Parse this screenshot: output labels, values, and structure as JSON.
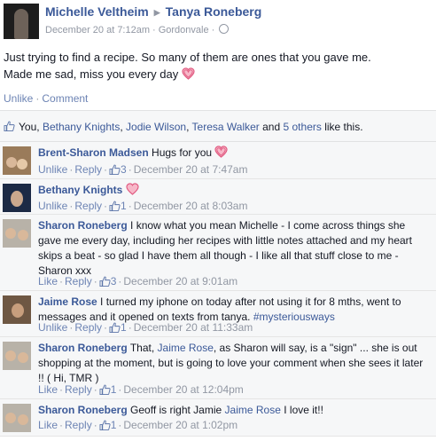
{
  "post": {
    "author": "Michelle Veltheim",
    "target": "Tanya Roneberg",
    "timestamp": "December 20 at 7:12am",
    "location": "Gordonvale",
    "text_line1": "Just trying to find a recipe. So many of them are ones that you gave me.",
    "text_line2": "Made me sad, miss you every day",
    "actions": {
      "unlike": "Unlike",
      "comment": "Comment"
    },
    "heart_icon": "heart-icon",
    "privacy_icon": "globe-icon"
  },
  "likes": {
    "you": "You",
    "comma": ",",
    "name1": "Bethany Knights",
    "name2": "Jodie Wilson",
    "name3": "Teresa Walker",
    "and": "and",
    "others": "5 others",
    "suffix": "like this."
  },
  "comments": [
    {
      "author": "Brent-Sharon Madsen",
      "text": "Hugs for you",
      "like_action": "Unlike",
      "reply": "Reply",
      "likes": "3",
      "time": "December 20 at 7:47am"
    },
    {
      "author": "Bethany Knights",
      "text": "",
      "like_action": "Unlike",
      "reply": "Reply",
      "likes": "1",
      "time": "December 20 at 8:03am"
    },
    {
      "author": "Sharon Roneberg",
      "text": "I know what you mean Michelle - I come across things she gave me every day, including her recipes with little notes attached and my heart skips a beat - so glad I have them all though - I like all that stuff close to me - Sharon xxx",
      "like_action": "Like",
      "reply": "Reply",
      "likes": "3",
      "time": "December 20 at 9:01am"
    },
    {
      "author": "Jaime Rose",
      "text": "I turned my iphone on today after not using it for 8 mths, went to messages and it opened on texts from tanya.",
      "hashtag": "#mysteriousways",
      "like_action": "Unlike",
      "reply": "Reply",
      "likes": "1",
      "time": "December 20 at 11:33am"
    },
    {
      "author": "Sharon Roneberg",
      "text_before": "That,",
      "mention": "Jaime Rose",
      "text_after": ", as Sharon will say, is a \"sign\" ... she is out shopping at the moment, but is going to love your comment when she sees it later !! ( Hi, TMR )",
      "like_action": "Like",
      "reply": "Reply",
      "likes": "1",
      "time": "December 20 at 12:04pm"
    },
    {
      "author": "Sharon Roneberg",
      "text_before": "Geoff is right Jamie",
      "mention": "Jaime Rose",
      "text_after": "I love it!!",
      "like_action": "Like",
      "reply": "Reply",
      "likes": "1",
      "time": "December 20 at 1:02pm"
    }
  ],
  "colors": {
    "link": "#3b5998",
    "action_link": "#6d84b4",
    "meta_gray": "#9197a3",
    "comment_bg": "#f6f7f8",
    "heart": "#f0729a"
  }
}
